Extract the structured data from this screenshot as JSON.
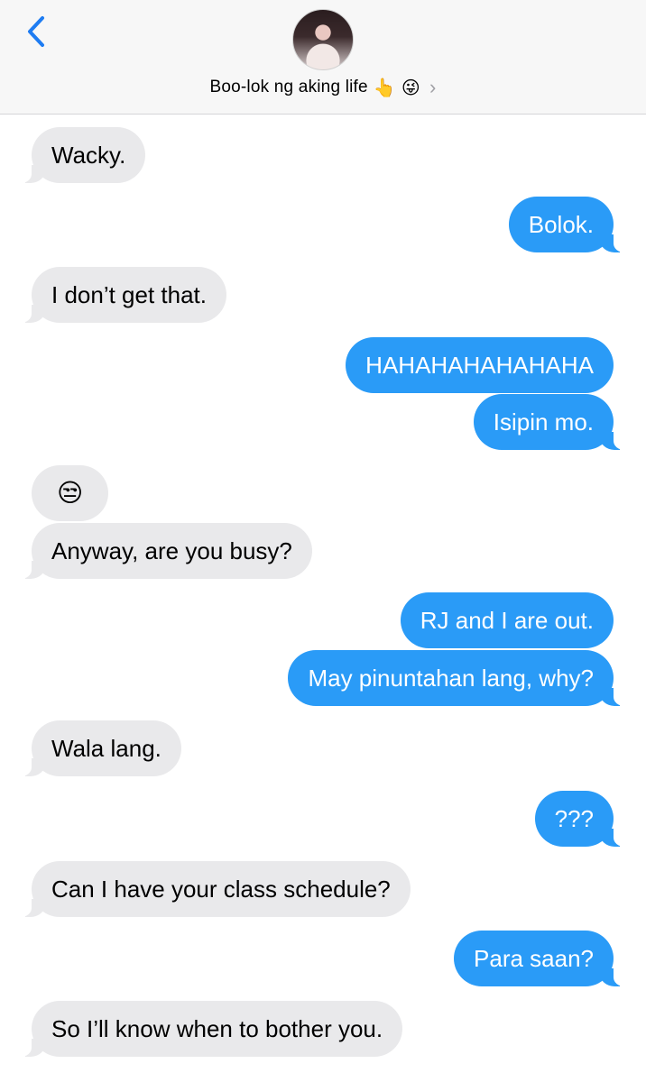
{
  "header": {
    "contact_name": "Boo-lok ng aking life",
    "name_emoji_1": "👆",
    "name_emoji_2": "😜",
    "chevron": "›"
  },
  "messages": [
    {
      "from": "them",
      "text": "Wacky."
    },
    {
      "from": "me",
      "text": "Bolok."
    },
    {
      "from": "them",
      "text": "I don’t get that."
    },
    {
      "from": "me",
      "text": "HAHAHAHAHAHAHA"
    },
    {
      "from": "me",
      "text": "Isipin mo."
    },
    {
      "from": "them",
      "text": "😒"
    },
    {
      "from": "them",
      "text": "Anyway, are you busy?"
    },
    {
      "from": "me",
      "text": "RJ and I are out."
    },
    {
      "from": "me",
      "text": "May pinuntahan lang, why?"
    },
    {
      "from": "them",
      "text": "Wala lang."
    },
    {
      "from": "me",
      "text": "???"
    },
    {
      "from": "them",
      "text": "Can I have your class schedule?"
    },
    {
      "from": "me",
      "text": "Para saan?"
    },
    {
      "from": "them",
      "text": "So I’ll know when to bother you."
    }
  ],
  "colors": {
    "outgoing_bubble": "#2a9bf7",
    "incoming_bubble": "#e9e9eb",
    "accent": "#1e7cf2"
  },
  "icons": {
    "back": "chevron-left-icon",
    "contact_detail": "chevron-right-icon"
  }
}
